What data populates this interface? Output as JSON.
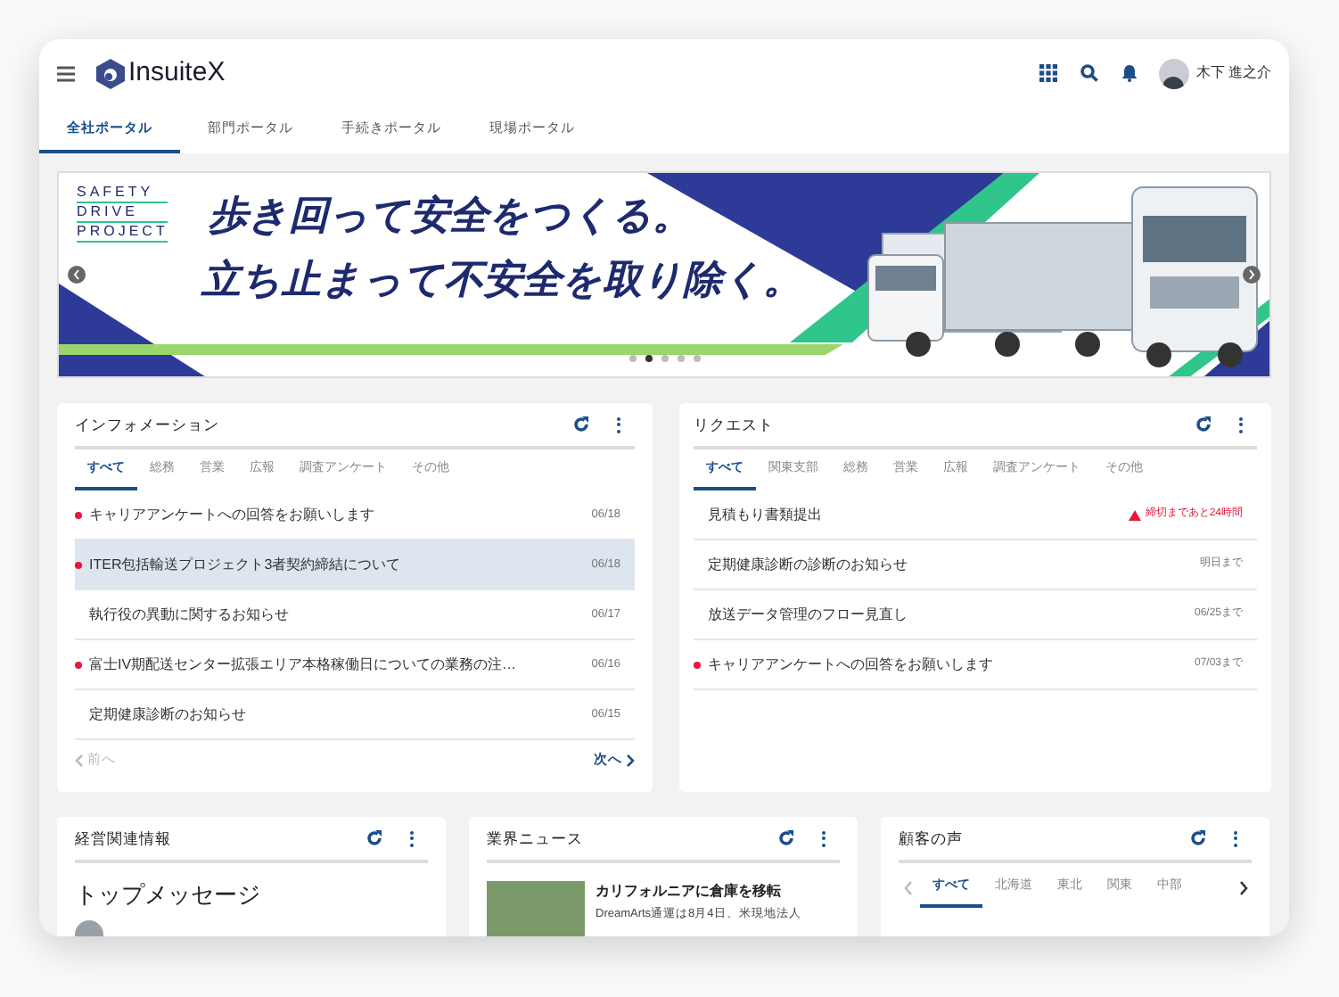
{
  "header": {
    "logo": "InsuiteX",
    "user": "木下 進之介"
  },
  "portal_tabs": [
    {
      "label": "全社ポータル",
      "selected": true
    },
    {
      "label": "部門ポータル",
      "selected": false
    },
    {
      "label": "手続きポータル",
      "selected": false
    },
    {
      "label": "現場ポータル",
      "selected": false
    }
  ],
  "banner": {
    "project": [
      "SAFETY",
      "DRIVE",
      "PROJECT"
    ],
    "headline": [
      "歩き回って安全をつくる。",
      "立ち止まって不安全を取り除く。"
    ],
    "dots": [
      {
        "selected": false
      },
      {
        "selected": true
      },
      {
        "selected": false
      },
      {
        "selected": false
      },
      {
        "selected": false
      }
    ]
  },
  "information": {
    "title": "インフォメーション",
    "tabs": [
      {
        "label": "すべて",
        "selected": true
      },
      {
        "label": "総務",
        "selected": false
      },
      {
        "label": "営業",
        "selected": false
      },
      {
        "label": "広報",
        "selected": false
      },
      {
        "label": "調査アンケート",
        "selected": false
      },
      {
        "label": "その他",
        "selected": false
      }
    ],
    "items": [
      {
        "title": "キャリアアンケートへの回答をお願いします",
        "date": "06/18",
        "unread": true,
        "selected": false
      },
      {
        "title": "ITER包括輸送プロジェクト3者契約締結について",
        "date": "06/18",
        "unread": true,
        "selected": true
      },
      {
        "title": "執行役の異動に関するお知らせ",
        "date": "06/17",
        "unread": false,
        "selected": false
      },
      {
        "title": "富士IV期配送センター拡張エリア本格稼働日についての業務の注…",
        "date": "06/16",
        "unread": true,
        "selected": false
      },
      {
        "title": "定期健康診断のお知らせ",
        "date": "06/15",
        "unread": false,
        "selected": false
      }
    ],
    "prev": {
      "label": "前へ",
      "disabled": true
    },
    "next": {
      "label": "次へ",
      "disabled": false
    }
  },
  "request": {
    "title": "リクエスト",
    "tabs": [
      {
        "label": "すべて",
        "selected": true
      },
      {
        "label": "関東支部",
        "selected": false
      },
      {
        "label": "総務",
        "selected": false
      },
      {
        "label": "営業",
        "selected": false
      },
      {
        "label": "広報",
        "selected": false
      },
      {
        "label": "調査アンケート",
        "selected": false
      },
      {
        "label": "その他",
        "selected": false
      }
    ],
    "items": [
      {
        "title": "見積もり書類提出",
        "due": "締切まであと24時間",
        "kind": "warning",
        "unread": false
      },
      {
        "title": "定期健康診断の診断のお知らせ",
        "due": "明日まで",
        "kind": "normal",
        "unread": false
      },
      {
        "title": "放送データ管理のフロー見直し",
        "due": "06/25まで",
        "kind": "normal",
        "unread": false
      },
      {
        "title": "キャリアアンケートへの回答をお願いします",
        "due": "07/03まで",
        "kind": "normal",
        "unread": true
      }
    ]
  },
  "management": {
    "title": "経営関連情報",
    "heading": "トップメッセージ"
  },
  "industry_news": {
    "title": "業界ニュース",
    "headline": "カリフォルニアに倉庫を移転",
    "snippet": "DreamArts通運は8月4日、米現地法人"
  },
  "customer_voice": {
    "title": "顧客の声",
    "tabs": [
      {
        "label": "すべて",
        "selected": true
      },
      {
        "label": "北海道",
        "selected": false
      },
      {
        "label": "東北",
        "selected": false
      },
      {
        "label": "関東",
        "selected": false
      },
      {
        "label": "中部",
        "selected": false
      }
    ],
    "prev_disabled": true
  }
}
